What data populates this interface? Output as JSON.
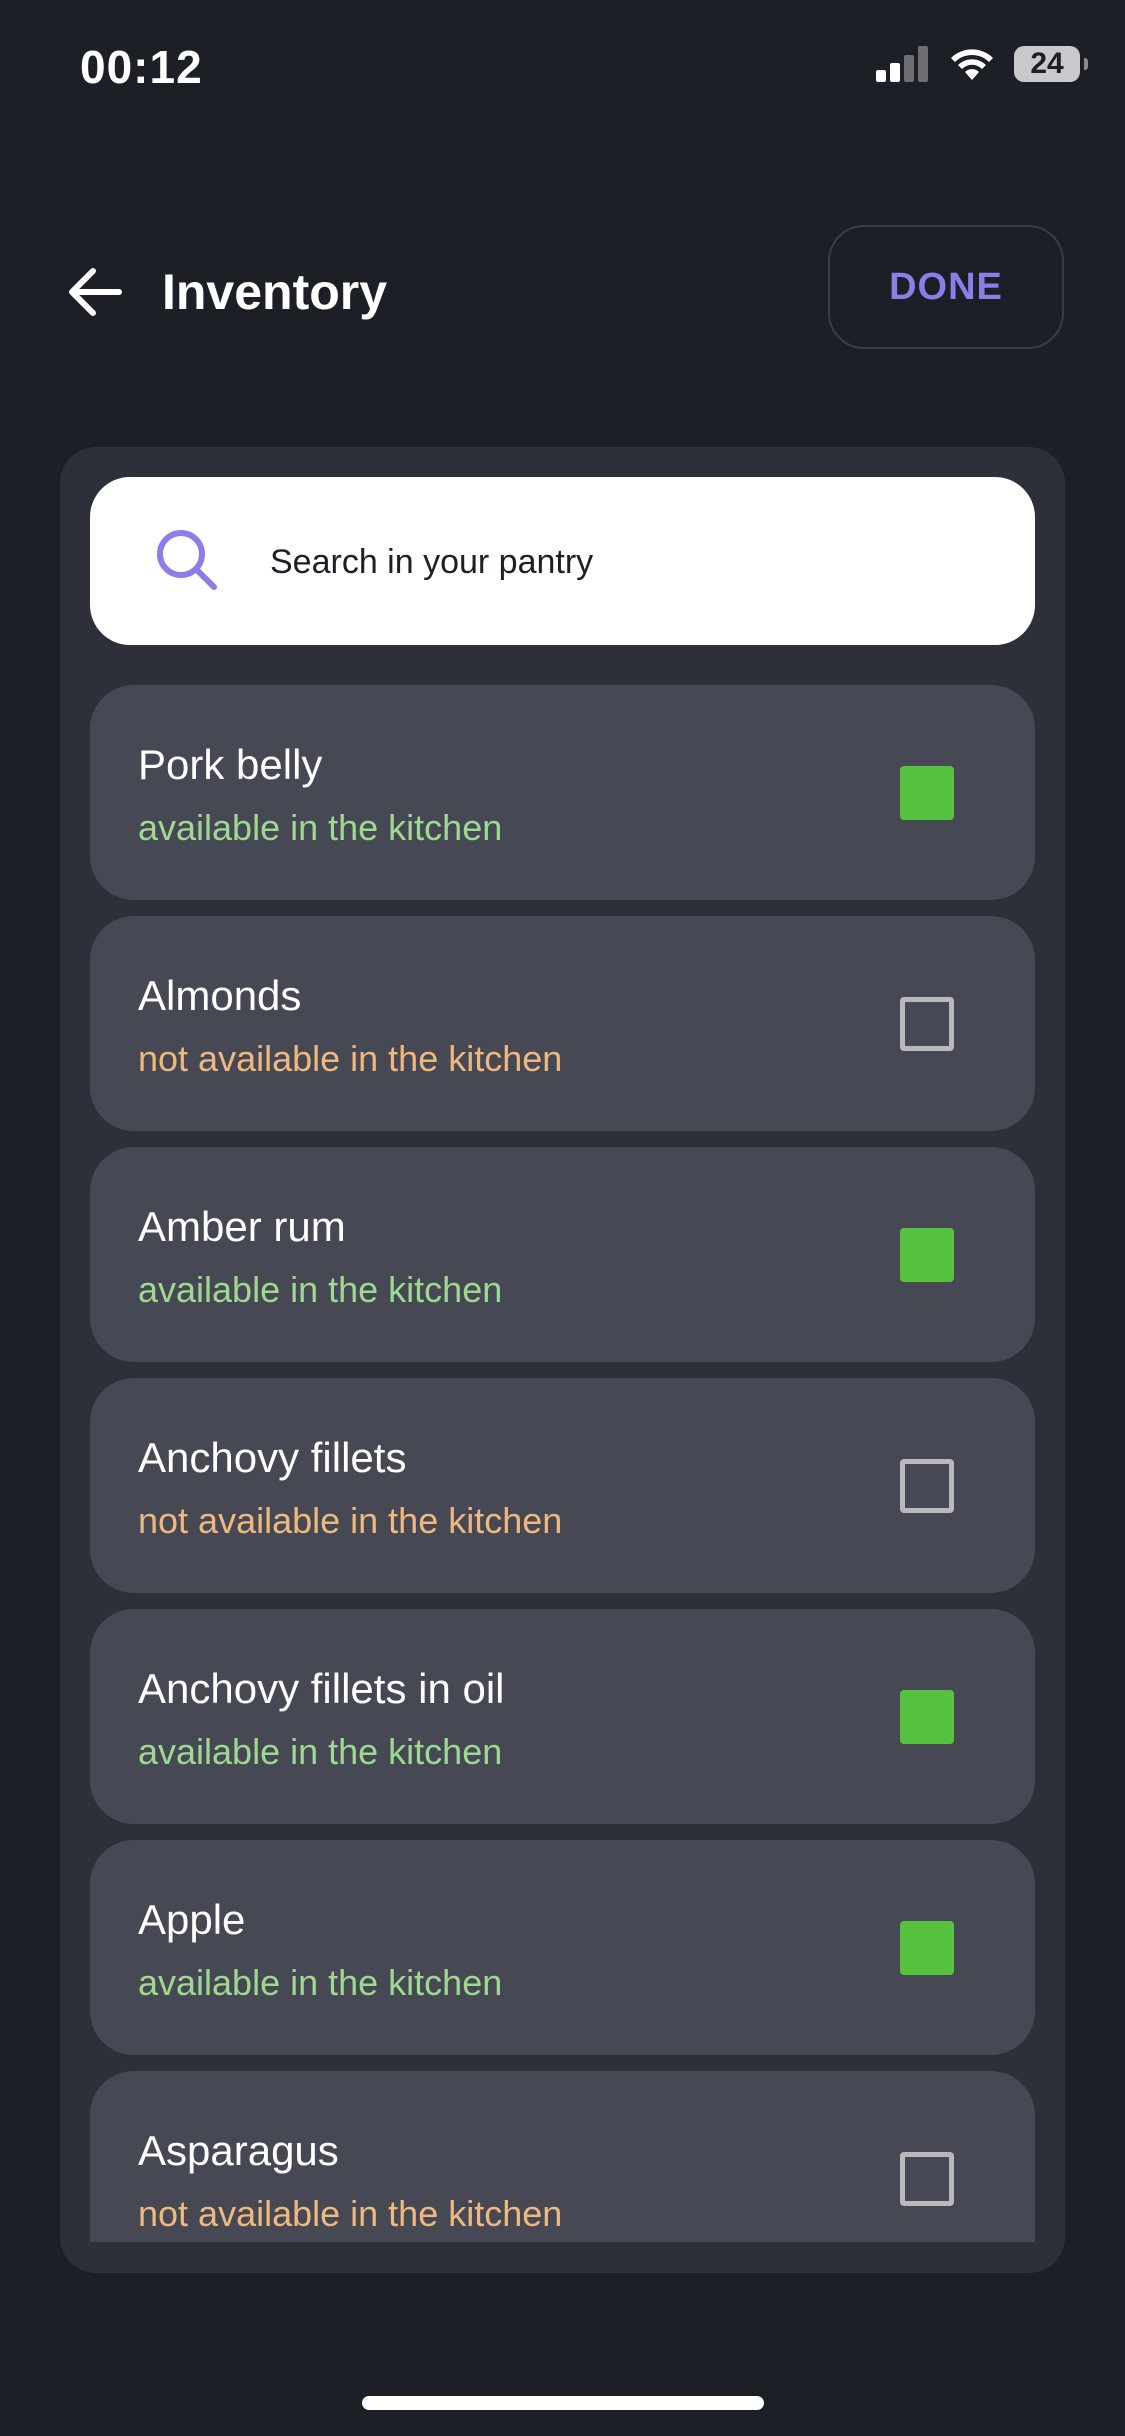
{
  "status_bar": {
    "time": "00:12",
    "battery": "24",
    "icons": [
      "signal-icon",
      "wifi-icon",
      "battery-icon"
    ]
  },
  "header": {
    "title": "Inventory",
    "done_label": "DONE",
    "back_icon": "arrow-left-icon"
  },
  "search": {
    "placeholder": "Search in your pantry",
    "icon": "search-icon"
  },
  "colors": {
    "accent": "#8b7ee8",
    "available": "#9ed891",
    "unavailable": "#efb87f",
    "checked": "#57c23f"
  },
  "items": [
    {
      "name": " Pork belly",
      "status": "available in the kitchen",
      "available": true
    },
    {
      "name": "Almonds",
      "status": "not available in the kitchen",
      "available": false
    },
    {
      "name": "Amber rum",
      "status": "available in the kitchen",
      "available": true
    },
    {
      "name": "Anchovy fillets",
      "status": "not available in the kitchen",
      "available": false
    },
    {
      "name": "Anchovy fillets in oil",
      "status": "available in the kitchen",
      "available": true
    },
    {
      "name": "Apple",
      "status": "available in the kitchen",
      "available": true
    },
    {
      "name": "Asparagus",
      "status": "not available in the kitchen",
      "available": false
    }
  ]
}
